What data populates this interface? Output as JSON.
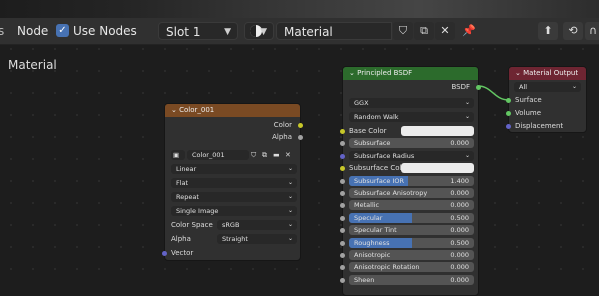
{
  "header": {
    "editor_label": "Node",
    "use_nodes_label": "Use Nodes",
    "slot_value": "Slot 1",
    "material_value": "Material"
  },
  "canvas_label": "Material",
  "image_node": {
    "title": "Color_001",
    "outputs": [
      "Color",
      "Alpha"
    ],
    "image_name": "Color_001",
    "interpolation": "Linear",
    "projection": "Flat",
    "extension": "Repeat",
    "source": "Single Image",
    "color_space_label": "Color Space",
    "color_space": "sRGB",
    "alpha_label": "Alpha",
    "alpha": "Straight",
    "vector_label": "Vector"
  },
  "bsdf_node": {
    "title": "Principled BSDF",
    "output": "BSDF",
    "distribution": "GGX",
    "subsurface_method": "Random Walk",
    "rows": [
      {
        "label": "Base Color",
        "kind": "color"
      },
      {
        "label": "Subsurface",
        "value": "0.000"
      },
      {
        "label": "Subsurface Radius",
        "kind": "dropdown"
      },
      {
        "label": "Subsurface Color",
        "kind": "color"
      },
      {
        "label": "Subsurface IOR",
        "value": "1.400",
        "fill": 0.47
      },
      {
        "label": "Subsurface Anisotropy",
        "value": "0.000"
      },
      {
        "label": "Metallic",
        "value": "0.000"
      },
      {
        "label": "Specular",
        "value": "0.500",
        "fill": 0.5
      },
      {
        "label": "Specular Tint",
        "value": "0.000"
      },
      {
        "label": "Roughness",
        "value": "0.500",
        "fill": 0.5
      },
      {
        "label": "Anisotropic",
        "value": "0.000"
      },
      {
        "label": "Anisotropic Rotation",
        "value": "0.000"
      },
      {
        "label": "Sheen",
        "value": "0.000"
      }
    ]
  },
  "output_node": {
    "title": "Material Output",
    "target": "All",
    "inputs": [
      "Surface",
      "Volume",
      "Displacement"
    ]
  },
  "colors": {
    "image_header": "#7a4a23",
    "bsdf_header": "#2c6b2c",
    "output_header": "#6e2532",
    "color_socket": "#c7c729",
    "float_socket": "#a1a1a1",
    "vector_socket": "#6363c7",
    "shader_socket": "#63c763",
    "accent": "#4772b3"
  }
}
